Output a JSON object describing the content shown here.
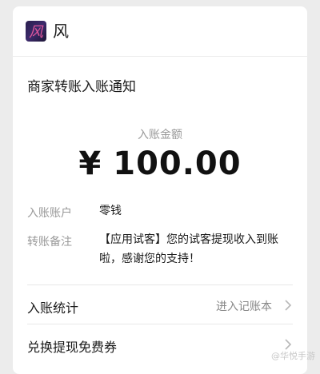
{
  "header": {
    "logo_icon": "wind-logo-icon",
    "logo_char": "风",
    "app_name": "风"
  },
  "notice": {
    "title": "商家转账入账通知",
    "amount_label": "入账金额",
    "currency_symbol": "¥",
    "amount": "100.00"
  },
  "details": {
    "account_label": "入账账户",
    "account_value": "零钱",
    "remark_label": "转账备注",
    "remark_value": "【应用试客】您的试客提现收入到账啦，感谢您的支持！"
  },
  "links": [
    {
      "label": "入账统计",
      "right_text": "进入记账本",
      "icon": "chevron-right-icon"
    },
    {
      "label": "兑换提现免费券",
      "right_text": "",
      "icon": "chevron-right-icon"
    }
  ],
  "watermark": "@华悦手游",
  "colors": {
    "background": "#ececec",
    "card": "#ffffff",
    "muted_text": "#999999",
    "primary_text": "#1a1a1a",
    "logo_accent": "#e0569b"
  }
}
